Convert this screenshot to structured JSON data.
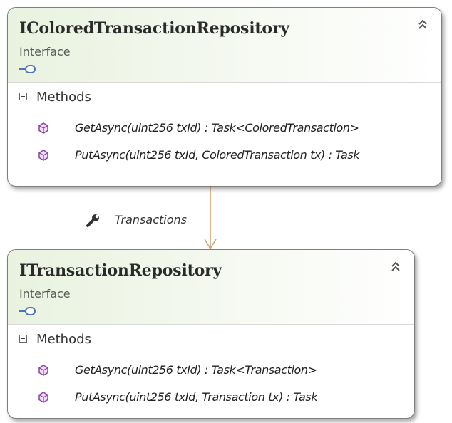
{
  "classes": [
    {
      "title": "IColoredTransactionRepository",
      "stereotype": "Interface",
      "section": "Methods",
      "methods": [
        "GetAsync(uint256 txId) : Task<ColoredTransaction>",
        "PutAsync(uint256 txId, ColoredTransaction tx) : Task"
      ]
    },
    {
      "title": "ITransactionRepository",
      "stereotype": "Interface",
      "section": "Methods",
      "methods": [
        "GetAsync(uint256 txId) : Task<Transaction>",
        "PutAsync(uint256 txId, Transaction tx) : Task"
      ]
    }
  ],
  "association": {
    "label": "Transactions"
  },
  "icons": {
    "collapse": "double-chevron-up-icon",
    "interface": "interface-lollipop-icon",
    "method": "method-cube-icon",
    "property": "wrench-icon"
  },
  "colors": {
    "header_tint": "#e9f2df",
    "arrow": "#c8a06e",
    "method_icon": "#8a3fa8"
  }
}
